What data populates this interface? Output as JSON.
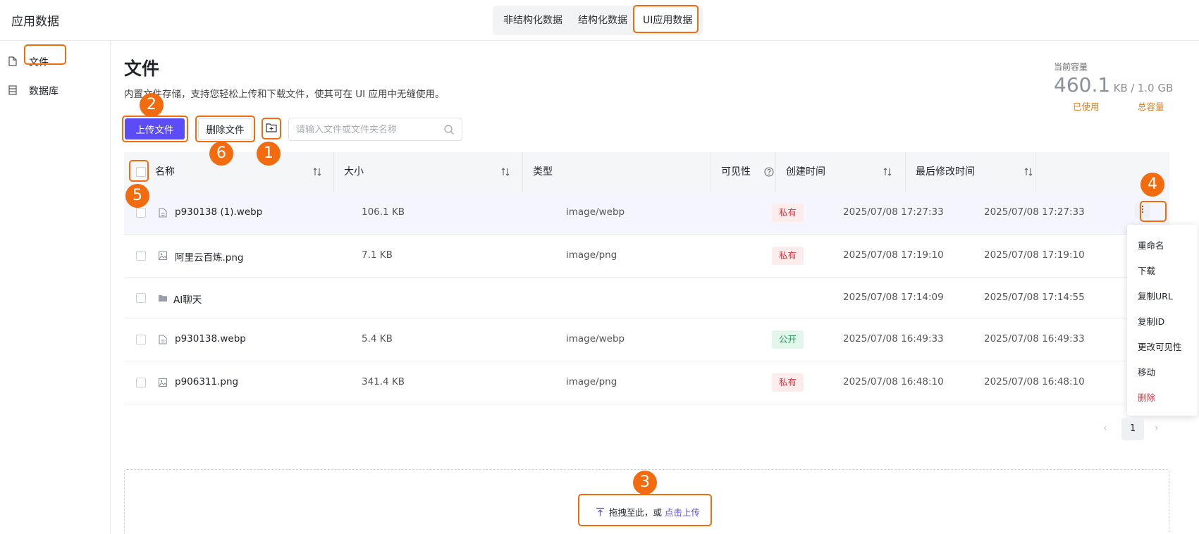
{
  "app": {
    "title": "应用数据"
  },
  "header_tabs": [
    "非结构化数据",
    "结构化数据",
    "UI应用数据"
  ],
  "sidebar": {
    "items": [
      {
        "label": "文件",
        "icon": "file-icon"
      },
      {
        "label": "数据库",
        "icon": "database-icon"
      }
    ]
  },
  "page": {
    "title": "文件",
    "description": "内置文件存储，支持您轻松上传和下载文件，使其可在 UI 应用中无缝使用。"
  },
  "capacity": {
    "label": "当前容量",
    "used_value": "460.1",
    "used_unit": "KB",
    "separator": "/",
    "total": "1.0 GB",
    "used_label": "已使用",
    "total_label": "总容量"
  },
  "toolbar": {
    "upload_label": "上传文件",
    "delete_label": "删除文件",
    "new_folder_icon": "new-folder-icon",
    "search_placeholder": "请输入文件或文件夹名称"
  },
  "table": {
    "columns": [
      "名称",
      "大小",
      "类型",
      "可见性",
      "创建时间",
      "最后修改时间"
    ],
    "rows": [
      {
        "name": "p930138 (1).webp",
        "icon": "file-icon",
        "size": "106.1 KB",
        "type": "image/webp",
        "visibility": "私有",
        "visibility_kind": "private",
        "created": "2025/07/08 17:27:33",
        "modified": "2025/07/08 17:27:33"
      },
      {
        "name": "阿里云百炼.png",
        "icon": "image-icon",
        "size": "7.1 KB",
        "type": "image/png",
        "visibility": "私有",
        "visibility_kind": "private",
        "created": "2025/07/08 17:19:10",
        "modified": "2025/07/08 17:19:10"
      },
      {
        "name": "AI聊天",
        "icon": "folder-icon",
        "size": "",
        "type": "",
        "visibility": "",
        "visibility_kind": "",
        "created": "2025/07/08 17:14:09",
        "modified": "2025/07/08 17:14:55"
      },
      {
        "name": "p930138.webp",
        "icon": "file-icon",
        "size": "5.4 KB",
        "type": "image/webp",
        "visibility": "公开",
        "visibility_kind": "public",
        "created": "2025/07/08 16:49:33",
        "modified": "2025/07/08 16:49:33"
      },
      {
        "name": "p906311.png",
        "icon": "image-icon",
        "size": "341.4 KB",
        "type": "image/png",
        "visibility": "私有",
        "visibility_kind": "private",
        "created": "2025/07/08 16:48:10",
        "modified": "2025/07/08 16:48:10"
      }
    ]
  },
  "row_menu": {
    "items": [
      "重命名",
      "下载",
      "复制URL",
      "复制ID",
      "更改可见性",
      "移动",
      "删除"
    ]
  },
  "pagination": {
    "current": "1"
  },
  "dropzone": {
    "text": "拖拽至此，或",
    "link": "点击上传"
  },
  "annotation_markers": [
    "1",
    "2",
    "3",
    "4",
    "5",
    "6"
  ],
  "colors": {
    "primary": "#5b4cf5",
    "annotation": "#f26b0f",
    "private_text": "#d9363e",
    "public_text": "#1f9d57",
    "capacity_label": "#e07b1a"
  }
}
